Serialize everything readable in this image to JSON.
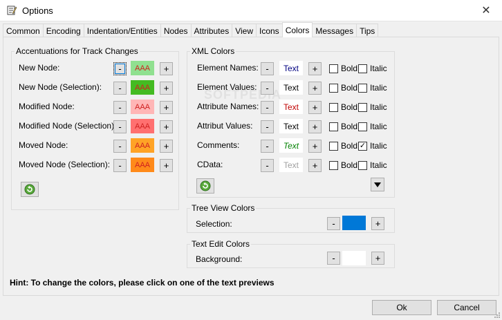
{
  "window": {
    "title": "Options",
    "close_glyph": "✕"
  },
  "tabs": [
    {
      "label": "Common"
    },
    {
      "label": "Encoding"
    },
    {
      "label": "Indentation/Entities"
    },
    {
      "label": "Nodes"
    },
    {
      "label": "Attributes"
    },
    {
      "label": "View"
    },
    {
      "label": "Icons"
    },
    {
      "label": "Colors",
      "active": true
    },
    {
      "label": "Messages"
    },
    {
      "label": "Tips"
    }
  ],
  "track_changes": {
    "title": "Accentuations for Track Changes",
    "minus": "-",
    "plus": "+",
    "rows": [
      {
        "label": "New Node:",
        "sample": "AAA",
        "bg": "#90e090",
        "fg": "#d02020"
      },
      {
        "label": "New Node (Selection):",
        "sample": "AAA",
        "bg": "#44bb22",
        "fg": "#d02020"
      },
      {
        "label": "Modified Node:",
        "sample": "AAA",
        "bg": "#ffb6b6",
        "fg": "#d02020"
      },
      {
        "label": "Modified Node (Selection):",
        "sample": "AAA",
        "bg": "#ff7070",
        "fg": "#d02020"
      },
      {
        "label": "Moved Node:",
        "sample": "AAA",
        "bg": "#ffa326",
        "fg": "#d02020"
      },
      {
        "label": "Moved Node (Selection):",
        "sample": "AAA",
        "bg": "#ff8a1a",
        "fg": "#d02020"
      }
    ]
  },
  "xml_colors": {
    "title": "XML Colors",
    "minus": "-",
    "plus": "+",
    "bold_label": "Bold",
    "italic_label": "Italic",
    "check_glyph": "✓",
    "rows": [
      {
        "label": "Element Names:",
        "preview": "Text",
        "color": "#000080",
        "bold": false,
        "italic": false
      },
      {
        "label": "Element Values:",
        "preview": "Text",
        "color": "#000000",
        "bold": false,
        "italic": false
      },
      {
        "label": "Attribute Names:",
        "preview": "Text",
        "color": "#c00000",
        "bold": false,
        "italic": false
      },
      {
        "label": "Attribut Values:",
        "preview": "Text",
        "color": "#000000",
        "bold": false,
        "italic": false
      },
      {
        "label": "Comments:",
        "preview": "Text",
        "color": "#008000",
        "bold": false,
        "italic": true
      },
      {
        "label": "CData:",
        "preview": "Text",
        "color": "#a0a0a0",
        "bold": false,
        "italic": false
      }
    ]
  },
  "tree_view": {
    "title": "Tree View Colors",
    "label": "Selection:",
    "color": "#0078d7",
    "minus": "-",
    "plus": "+"
  },
  "text_edit": {
    "title": "Text Edit Colors",
    "label": "Background:",
    "color": "#ffffff",
    "minus": "-",
    "plus": "+"
  },
  "hint": "Hint: To change the colors, please click on one of the text previews",
  "footer": {
    "ok": "Ok",
    "cancel": "Cancel"
  },
  "watermark": "SOFTPEDIA"
}
